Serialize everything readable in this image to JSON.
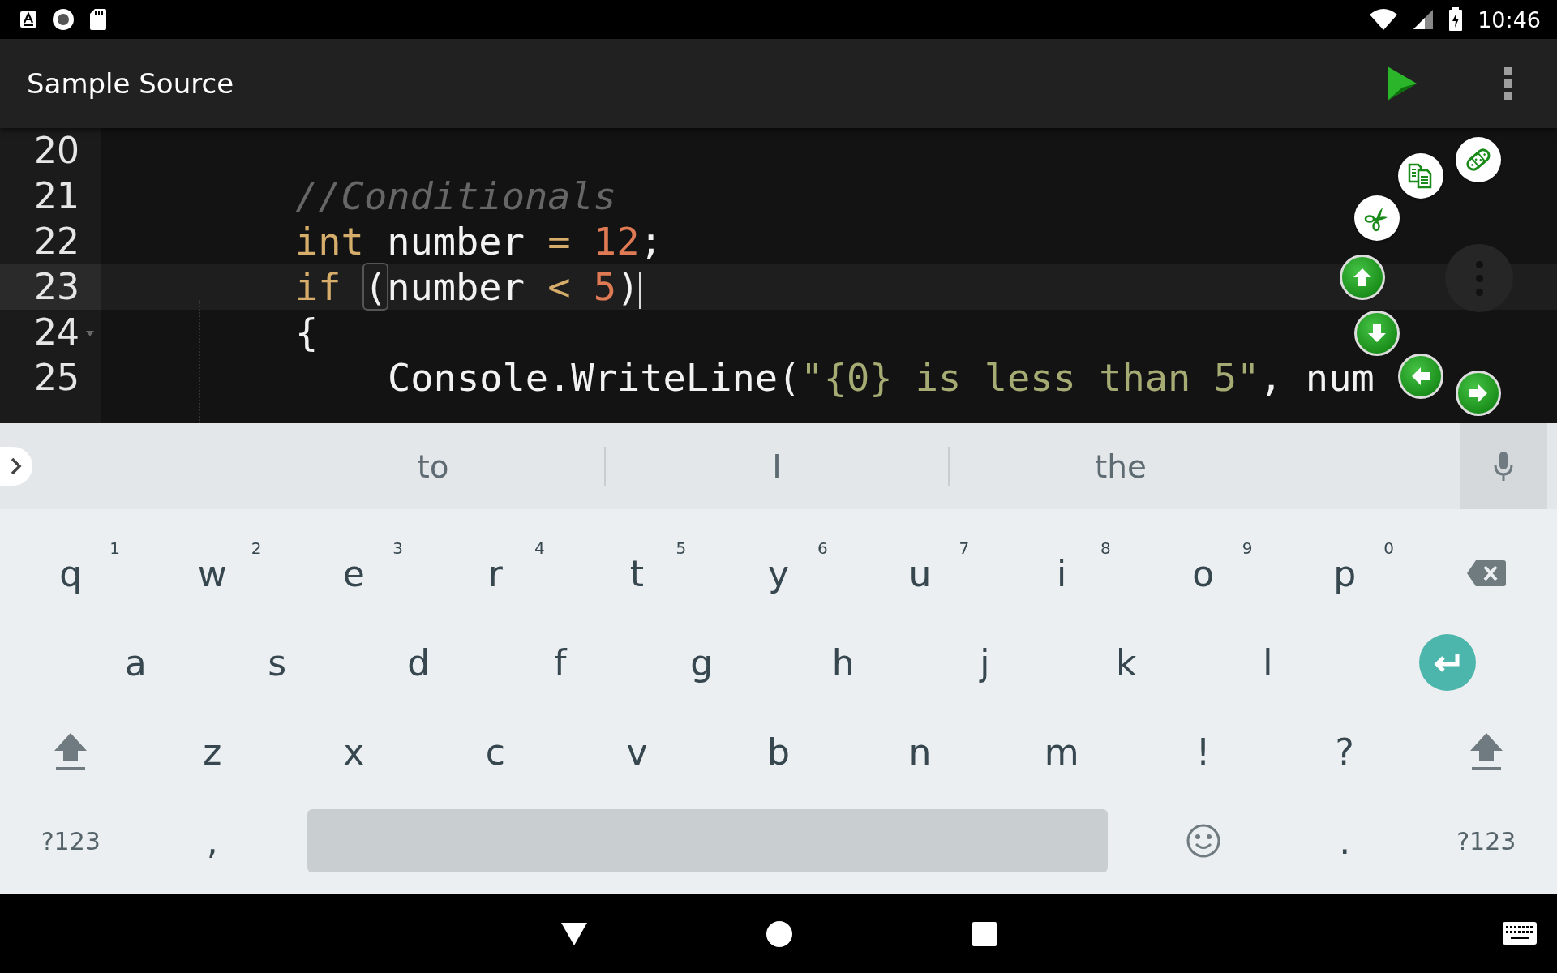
{
  "status_bar": {
    "time": "10:46"
  },
  "app_bar": {
    "title": "Sample Source"
  },
  "editor": {
    "lines": [
      {
        "number": "20",
        "kind": "blank",
        "current": false,
        "foldable": false
      },
      {
        "number": "21",
        "kind": "statement",
        "current": false,
        "foldable": false,
        "tokens": [
          {
            "kind": "comment",
            "text": "//Conditionals"
          }
        ]
      },
      {
        "number": "22",
        "kind": "statement",
        "current": false,
        "foldable": false,
        "tokens": [
          {
            "kind": "keyword",
            "text": "int"
          },
          {
            "kind": "plain",
            "text": " number "
          },
          {
            "kind": "operator",
            "text": "= "
          },
          {
            "kind": "number",
            "text": "12"
          },
          {
            "kind": "plain",
            "text": ";"
          }
        ]
      },
      {
        "number": "23",
        "kind": "statement",
        "current": true,
        "foldable": false,
        "tokens": [
          {
            "kind": "keyword",
            "text": "if "
          },
          {
            "kind": "bracket-match",
            "text": "("
          },
          {
            "kind": "plain",
            "text": "number "
          },
          {
            "kind": "operator",
            "text": "< "
          },
          {
            "kind": "number",
            "text": "5"
          },
          {
            "kind": "plain",
            "text": ")",
            "cursor_after": true
          }
        ]
      },
      {
        "number": "24",
        "kind": "statement",
        "current": false,
        "foldable": true,
        "tokens": [
          {
            "kind": "plain",
            "text": "{"
          }
        ]
      },
      {
        "number": "25",
        "kind": "nested",
        "current": false,
        "foldable": false,
        "tokens": [
          {
            "kind": "plain",
            "text": "Console.WriteLine("
          },
          {
            "kind": "string",
            "text": "\"{0} is less than 5\""
          },
          {
            "kind": "plain",
            "text": ", num"
          }
        ]
      }
    ]
  },
  "keyboard": {
    "suggestions": [
      "to",
      "I",
      "the"
    ],
    "rows": [
      [
        {
          "kind": "char",
          "label": "q",
          "hint": "1"
        },
        {
          "kind": "char",
          "label": "w",
          "hint": "2"
        },
        {
          "kind": "char",
          "label": "e",
          "hint": "3"
        },
        {
          "kind": "char",
          "label": "r",
          "hint": "4"
        },
        {
          "kind": "char",
          "label": "t",
          "hint": "5"
        },
        {
          "kind": "char",
          "label": "y",
          "hint": "6"
        },
        {
          "kind": "char",
          "label": "u",
          "hint": "7"
        },
        {
          "kind": "char",
          "label": "i",
          "hint": "8"
        },
        {
          "kind": "char",
          "label": "o",
          "hint": "9"
        },
        {
          "kind": "char",
          "label": "p",
          "hint": "0"
        },
        {
          "kind": "backspace"
        }
      ],
      [
        {
          "kind": "char",
          "label": "a"
        },
        {
          "kind": "char",
          "label": "s"
        },
        {
          "kind": "char",
          "label": "d"
        },
        {
          "kind": "char",
          "label": "f"
        },
        {
          "kind": "char",
          "label": "g"
        },
        {
          "kind": "char",
          "label": "h"
        },
        {
          "kind": "char",
          "label": "j"
        },
        {
          "kind": "char",
          "label": "k"
        },
        {
          "kind": "char",
          "label": "l"
        },
        {
          "kind": "enter"
        }
      ],
      [
        {
          "kind": "shift"
        },
        {
          "kind": "char",
          "label": "z"
        },
        {
          "kind": "char",
          "label": "x"
        },
        {
          "kind": "char",
          "label": "c"
        },
        {
          "kind": "char",
          "label": "v"
        },
        {
          "kind": "char",
          "label": "b"
        },
        {
          "kind": "char",
          "label": "n"
        },
        {
          "kind": "char",
          "label": "m"
        },
        {
          "kind": "char",
          "label": "!"
        },
        {
          "kind": "char",
          "label": "?"
        },
        {
          "kind": "shift"
        }
      ]
    ],
    "bottom_row": [
      {
        "kind": "symbols",
        "label": "?123"
      },
      {
        "kind": "char",
        "label": ","
      },
      {
        "kind": "space"
      },
      {
        "kind": "emoji"
      },
      {
        "kind": "char",
        "label": "."
      },
      {
        "kind": "symbols",
        "label": "?123"
      }
    ]
  }
}
